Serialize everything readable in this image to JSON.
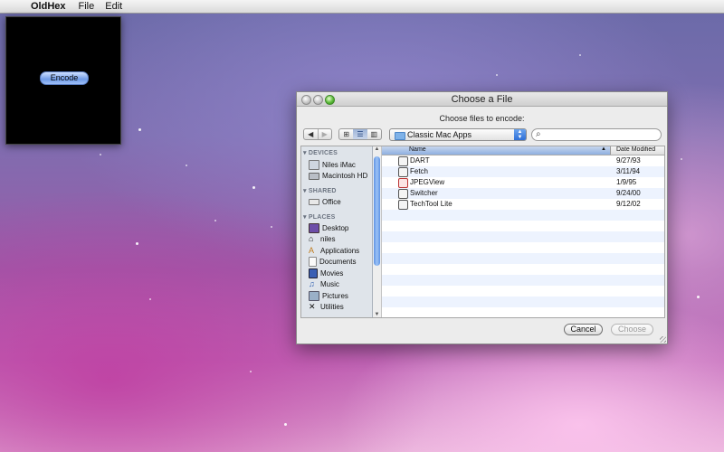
{
  "menubar": {
    "apple_glyph": "",
    "app_name": "OldHex",
    "menus": [
      "File",
      "Edit"
    ]
  },
  "hex_window": {
    "encode_label": "Encode"
  },
  "dialog": {
    "title": "Choose a File",
    "prompt": "Choose files to encode:",
    "location": "Classic Mac Apps",
    "search_value": "",
    "sidebar": {
      "sections": [
        {
          "heading": "DEVICES",
          "items": [
            {
              "label": "Niles iMac",
              "icon": "imac-icon"
            },
            {
              "label": "Macintosh HD",
              "icon": "hard-drive-icon"
            }
          ]
        },
        {
          "heading": "SHARED",
          "items": [
            {
              "label": "Office",
              "icon": "network-computer-icon"
            }
          ]
        },
        {
          "heading": "PLACES",
          "items": [
            {
              "label": "Desktop",
              "icon": "desktop-icon"
            },
            {
              "label": "niles",
              "icon": "home-icon"
            },
            {
              "label": "Applications",
              "icon": "applications-icon"
            },
            {
              "label": "Documents",
              "icon": "documents-icon"
            },
            {
              "label": "Movies",
              "icon": "movies-icon"
            },
            {
              "label": "Music",
              "icon": "music-icon"
            },
            {
              "label": "Pictures",
              "icon": "pictures-icon"
            },
            {
              "label": "Utilities",
              "icon": "utilities-icon"
            }
          ]
        }
      ]
    },
    "columns": {
      "name": "Name",
      "date": "Date Modified"
    },
    "files": [
      {
        "name": "DART",
        "date": "9/27/93"
      },
      {
        "name": "Fetch",
        "date": "3/11/94"
      },
      {
        "name": "JPEGView",
        "date": "1/9/95"
      },
      {
        "name": "Switcher",
        "date": "9/24/00"
      },
      {
        "name": "TechTool Lite",
        "date": "9/12/02"
      }
    ],
    "cancel_label": "Cancel",
    "choose_label": "Choose"
  },
  "colors": {
    "accent": "#3d7fe0",
    "selected_column": "#a9c3ea",
    "row_alt": "#edf3fe"
  }
}
